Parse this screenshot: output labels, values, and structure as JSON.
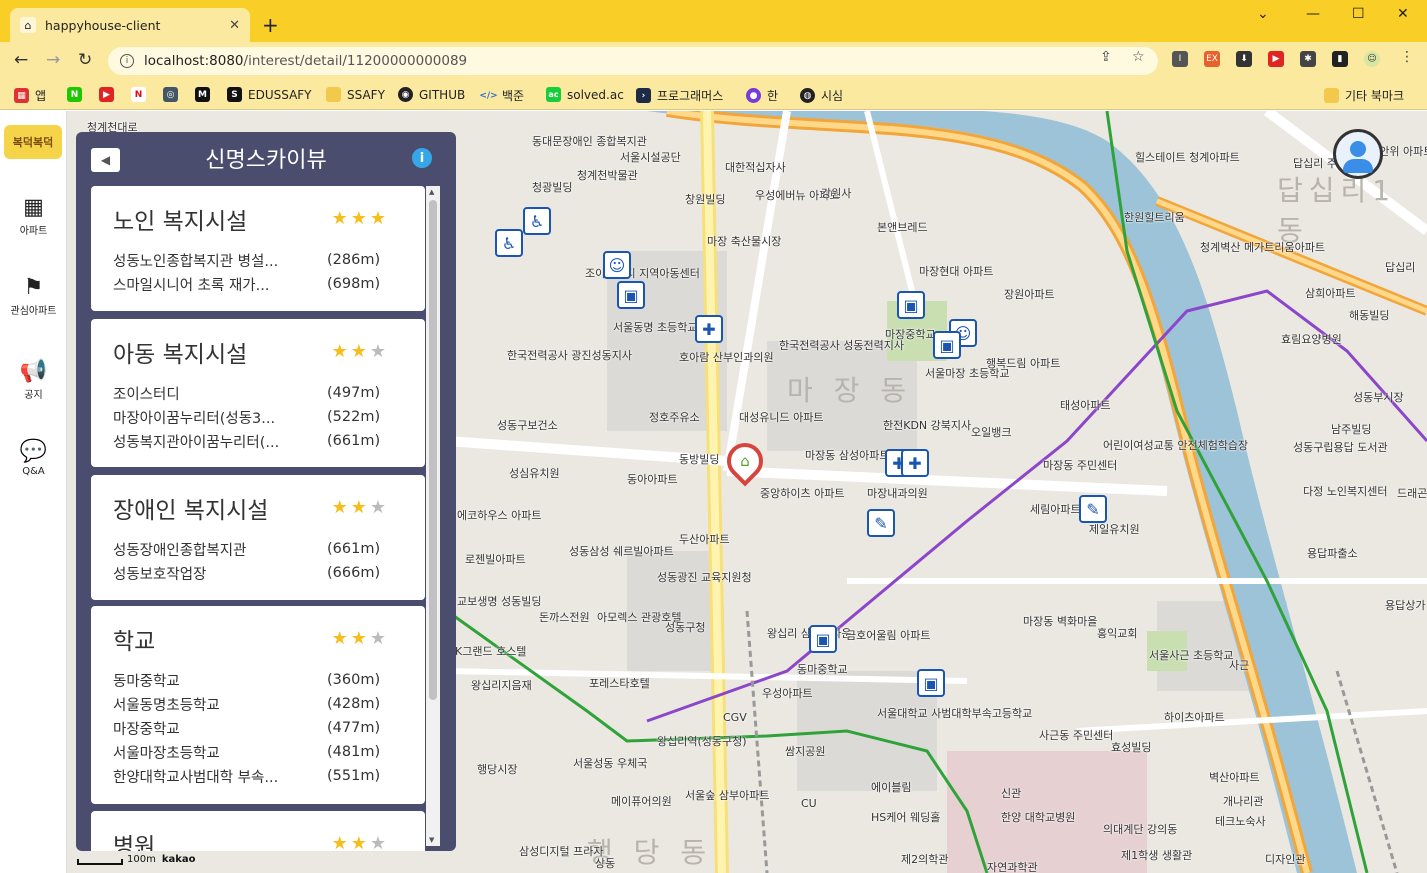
{
  "browser": {
    "tab_title": "happyhouse-client",
    "url_host": "localhost:8080",
    "url_path": "/interest/detail/11200000000089",
    "bookmarks": [
      "앱",
      "EDUSSAFY",
      "SSAFY",
      "GITHUB",
      "백준",
      "solved.ac",
      "프로그래머스",
      "한",
      "시심"
    ],
    "other_bookmarks": "기타 북마크"
  },
  "sidebar": {
    "logo": "복덕복덕",
    "items": [
      {
        "label": "아파트",
        "icon": "building-icon"
      },
      {
        "label": "관심아파트",
        "icon": "flag-icon"
      },
      {
        "label": "공지",
        "icon": "megaphone-icon"
      },
      {
        "label": "Q&A",
        "icon": "qa-icon"
      }
    ]
  },
  "panel": {
    "title": "신명스카이뷰",
    "cards": [
      {
        "title": "노인 복지시설",
        "stars": 3,
        "rows": [
          {
            "name": "성동노인종합복지관 병설...",
            "dist": "(286m)"
          },
          {
            "name": "스마일시니어 초록 재가...",
            "dist": "(698m)"
          }
        ]
      },
      {
        "title": "아동 복지시설",
        "stars": 2,
        "rows": [
          {
            "name": "조이스터디",
            "dist": "(497m)"
          },
          {
            "name": "마장아이꿈누리터(성동3...",
            "dist": "(522m)"
          },
          {
            "name": "성동복지관아이꿈누리터(...",
            "dist": "(661m)"
          }
        ]
      },
      {
        "title": "장애인 복지시설",
        "stars": 2,
        "rows": [
          {
            "name": "성동장애인종합복지관",
            "dist": "(661m)"
          },
          {
            "name": "성동보호작업장",
            "dist": "(666m)"
          }
        ]
      },
      {
        "title": "학교",
        "stars": 2,
        "rows": [
          {
            "name": "동마중학교",
            "dist": "(360m)"
          },
          {
            "name": "서울동명초등학교",
            "dist": "(428m)"
          },
          {
            "name": "마장중학교",
            "dist": "(477m)"
          },
          {
            "name": "서울마장초등학교",
            "dist": "(481m)"
          },
          {
            "name": "한양대학교사범대학 부속...",
            "dist": "(551m)"
          }
        ]
      },
      {
        "title": "병원",
        "stars": 2,
        "rows": []
      }
    ]
  },
  "map": {
    "dong_labels": [
      "마 장 동",
      "답십리1동",
      "행 당 동"
    ],
    "labels": [
      "청계천대로",
      "동대문장애인 종합복지관",
      "서울시설공단",
      "청계천박물관",
      "대한적십자사",
      "청광빌딩",
      "우성에버뉴 아파트",
      "강원사",
      "창원빌딩",
      "힐스테이트 청계아파트",
      "한원힐트리움",
      "청계벽산 메가트리움아파트",
      "삼희아파트",
      "해동빌딩",
      "효림요양병원",
      "답십리 주민센터",
      "레미안위 아파트",
      "답십리",
      "본앤브레드",
      "마장현대 아파트",
      "장원아파트",
      "마장 축산물시장",
      "서울동명 초등학교",
      "조이스터디 지역아동센터",
      "한국전력공사 광진성동지사",
      "호아람 산부인과의원",
      "한국전력공사 성동전력지사",
      "마장중학교",
      "서울마장 초등학교",
      "행복드림 아파트",
      "정호주유소",
      "대성유니드 아파트",
      "한전KDN 강북지사",
      "성동구보건소",
      "마장동 삼성아파트",
      "동방빌딩",
      "오일뱅크",
      "마장동 주민센터",
      "어린이여성교통 안전체험학습장",
      "태성아파트",
      "성심유치원",
      "동아아파트",
      "중앙하이츠 아파트",
      "마장내과의원",
      "세림아파트",
      "제일유치원",
      "성동구립용답 도서관",
      "다정 노인복지센터",
      "남주빌딩",
      "용답파출소",
      "드래곤",
      "두산아파트",
      "성동삼성 쉐르빌아파트",
      "성동광진 교육지원청",
      "돈까스전원",
      "아모렉스 관광호텔",
      "성동구청",
      "교보생명 성동빌딩",
      "로젠빌아파트",
      "에코하우스 아파트",
      "왕십리 삼성홈타운",
      "동마중학교",
      "금호어울림 아파트",
      "마장동 벽화마을",
      "홍익교회",
      "서울사근 초등학교",
      "사근",
      "우성아파트",
      "포레스타호텔",
      "왕십리지음재",
      "K그랜드 호스텔",
      "서울대학교 사범대학부속고등학교",
      "하이츠아파트",
      "사근동 주민센터",
      "효성빌딩",
      "벽산아파트",
      "개나리관",
      "테크노숙사",
      "신관",
      "한양 대학교병원",
      "의대계단 강의동",
      "제1학생 생활관",
      "디자인관",
      "서울성동 우체국",
      "메이퓨어의원",
      "서울숲 삼부아파트",
      "에이블림",
      "HS케어 웨딩홀",
      "제2의학관",
      "자연과학관",
      "삼성디지털 프라자",
      "쌈지공원",
      "행당시장",
      "왕십리역(성동구청)",
      "CGV",
      "CU",
      "용답상가",
      "성동부시장",
      "상동"
    ]
  },
  "colors": {
    "panel_bg": "#4a4d6e",
    "star_on": "#f7be1b",
    "star_off": "#bbbbbb",
    "tab_strip": "#f8ce27",
    "toolbar": "#fbe9a0",
    "river": "#8fb8cf",
    "expressway": "#f2a53a",
    "line5": "#8b46c9",
    "line2": "#2fa33a"
  }
}
